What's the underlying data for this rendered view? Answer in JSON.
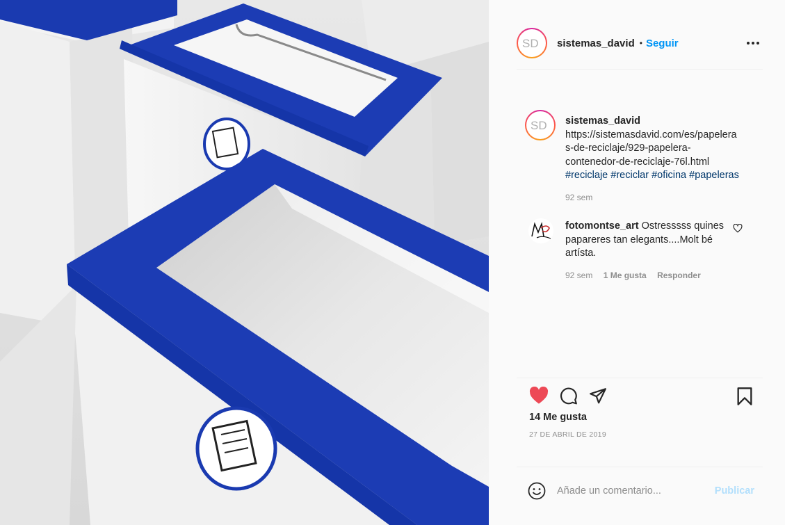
{
  "post": {
    "username": "sistemas_david",
    "follow_label": "Seguir",
    "separator": "•",
    "avatar_text": "SD",
    "caption": {
      "username": "sistemas_david",
      "url": "https://sistemasdavid.com/es/papeleras-de-reciclaje/929-papelera-contenedor-de-reciclaje-76l.html",
      "url_lines": [
        "https://sistemasdavid.com/es/papelera",
        "s-de-reciclaje/929-papelera-",
        "contenedor-de-reciclaje-76l.html"
      ],
      "hashtags": [
        "#reciclaje",
        "#reciclar",
        "#oficina",
        "#papeleras"
      ],
      "time": "92 sem"
    },
    "comments": [
      {
        "username": "fotomontse_art",
        "text": "Ostresssss quines papareres tan elegants....Molt bé artísta.",
        "time": "92 sem",
        "likes": "1 Me gusta",
        "reply_label": "Responder"
      }
    ],
    "likes_label": "14 Me gusta",
    "date": "27 DE ABRIL DE 2019",
    "add_comment_placeholder": "Añade un comentario...",
    "publish_label": "Publicar"
  },
  "icons": {
    "more": "more-options-icon",
    "like": "heart-filled-icon",
    "comment": "comment-icon",
    "share": "send-icon",
    "save": "bookmark-icon",
    "emoji": "emoji-icon",
    "comment_like": "heart-outline-icon"
  },
  "colors": {
    "accent": "#0095f6",
    "like_red": "#ed4956",
    "bin_blue": "#1a3ab0",
    "muted": "#8e8e8e",
    "publish_disabled": "#b2dffc"
  }
}
